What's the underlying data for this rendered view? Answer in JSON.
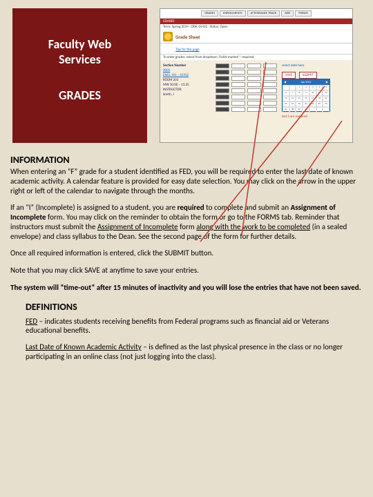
{
  "title": {
    "line1": "Faculty Web",
    "line2": "Services",
    "line3": "GRADES"
  },
  "screenshot": {
    "tabs": [
      "GRADES",
      "ENROLLMENTS",
      "ATTENDANCE TRACK",
      "ADD",
      "FORMS"
    ],
    "grade_sheet": "Grade Sheet",
    "tips": "Tips for this page",
    "left_labels": [
      "Section Number",
      "0001",
      "ENGL 101 – 65432",
      "ROOM 201",
      "MW 10:00 – 11:25",
      "INSTRUCTOR:",
      "Smith, J"
    ],
    "buttons": [
      "SAVE",
      "SUBMIT"
    ],
    "cal_note": "select date here",
    "red_label": "last 3 are required"
  },
  "info": {
    "heading": "INFORMATION",
    "p1a": "When entering an “F” grade for a student identified as FED, you will be required to enter the last date of known academic activity. A calendar feature is provided for easy date selection. You may click on the arrow in the upper right or left of the calendar to navigate through the months.",
    "p2_pre": "If an “I” (Incomplete) is assigned to a student, you are ",
    "p2_required": "required",
    "p2_mid1": " to complete and submit an ",
    "p2_form1": "Assignment of Incomplete",
    "p2_mid2": " form. You may click on the reminder to obtain the form or go to the FORMS tab. Reminder that instructors must submit the ",
    "p2_form2": "Assignment of Incomplete",
    "p2_mid3": " form ",
    "p2_along": "along with the work to be completed",
    "p2_tail": " (in a sealed envelope) and class syllabus to the Dean. See the second page of the form for further details.",
    "p3": "Once all required information is entered, click the SUBMIT button.",
    "p4": "Note that you may click SAVE at anytime to save your entries.",
    "p5": "The system will “time-out” after 15 minutes of inactivity and you will lose the entries that have not been saved."
  },
  "defs": {
    "heading": "DEFINITIONS",
    "d1_term": "FED",
    "d1_body": " – indicates students receiving benefits from Federal programs such as financial aid or Veterans educational benefits.",
    "d2_term": "Last Date of Known Academic Activity",
    "d2_body": " – is defined as the last physical presence in the class or no longer participating in an online class (not just logging into the class)."
  }
}
